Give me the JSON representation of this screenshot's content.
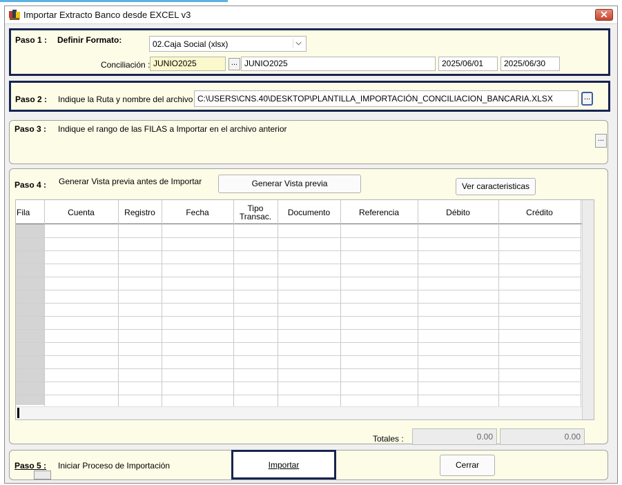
{
  "window": {
    "title": "Importar Extracto Banco desde EXCEL v3",
    "close_glyph": "✕"
  },
  "step1": {
    "label": "Paso 1 :",
    "format_label": "Definir Formato:",
    "format_value": "02.Caja Social (xlsx)",
    "conciliacion_label": "Conciliación :",
    "conciliacion_code": "JUNIO2025",
    "dots": "...",
    "conciliacion_name": "JUNIO2025",
    "date_from": "2025/06/01",
    "date_to": "2025/06/30"
  },
  "step2": {
    "label": "Paso 2 :",
    "text": "Indique la Ruta y nombre del archivo",
    "path": "C:\\USERS\\CNS.40\\DESKTOP\\PLANTILLA_IMPORTACIÓN_CONCILIACION_BANCARIA.XLSX",
    "dots": "..."
  },
  "step3": {
    "label": "Paso 3 :",
    "text": "Indique el rango de las FILAS a Importar en el archivo anterior",
    "dots": "..."
  },
  "step4": {
    "label": "Paso 4 :",
    "text": "Generar Vista previa antes de Importar",
    "preview_button": "Generar Vista previa",
    "features_button": "Ver caracteristicas",
    "columns": [
      "Fila",
      "Cuenta",
      "Registro",
      "Fecha",
      "Tipo\nTransac.",
      "Documento",
      "Referencia",
      "Débito",
      "Crédito"
    ],
    "totals_label": "Totales :",
    "total_debit": "0.00",
    "total_credit": "0.00"
  },
  "step5": {
    "label": "Paso 5 :",
    "text": "Iniciar Proceso de Importación",
    "import_button": "Importar",
    "close_button": "Cerrar"
  }
}
